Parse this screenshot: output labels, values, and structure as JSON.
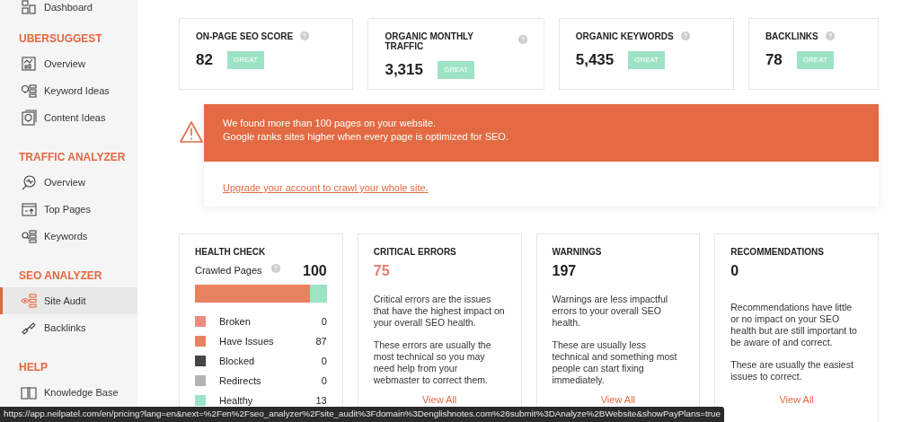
{
  "sidebar": {
    "items": [
      {
        "kind": "link",
        "label": "Dashboard",
        "selected": false
      },
      {
        "kind": "heading",
        "label": "UBERSUGGEST"
      },
      {
        "kind": "link",
        "label": "Overview",
        "selected": false
      },
      {
        "kind": "link",
        "label": "Keyword Ideas",
        "selected": false
      },
      {
        "kind": "link",
        "label": "Content Ideas",
        "selected": false
      },
      {
        "kind": "heading",
        "label": "TRAFFIC ANALYZER"
      },
      {
        "kind": "link",
        "label": "Overview",
        "selected": false
      },
      {
        "kind": "link",
        "label": "Top Pages",
        "selected": false
      },
      {
        "kind": "link",
        "label": "Keywords",
        "selected": false
      },
      {
        "kind": "heading",
        "label": "SEO ANALYZER"
      },
      {
        "kind": "link",
        "label": "Site Audit",
        "selected": true
      },
      {
        "kind": "link",
        "label": "Backlinks",
        "selected": false
      },
      {
        "kind": "heading",
        "label": "HELP"
      },
      {
        "kind": "link",
        "label": "Knowledge Base",
        "selected": false
      }
    ]
  },
  "metrics": [
    {
      "label": "ON-PAGE SEO SCORE",
      "value": "82",
      "badge": "GREAT"
    },
    {
      "label": "ORGANIC MONTHLY TRAFFIC",
      "value": "3,315",
      "badge": "GREAT"
    },
    {
      "label": "ORGANIC KEYWORDS",
      "value": "5,435",
      "badge": "GREAT"
    },
    {
      "label": "BACKLINKS",
      "value": "78",
      "badge": "GREAT"
    }
  ],
  "alert": {
    "lines": [
      "We found more than 100 pages on your website.",
      "Google ranks sites higher when every page is optimized for SEO."
    ],
    "link": "Upgrade your account to crawl your whole site."
  },
  "health_check": {
    "title": "HEALTH CHECK",
    "crawled_label": "Crawled Pages",
    "crawled_value": "100",
    "level": 0.87,
    "legend": [
      {
        "label": "Broken",
        "value": "0",
        "color": "#ef8a80"
      },
      {
        "label": "Have Issues",
        "value": "87",
        "color": "#e9825f"
      },
      {
        "label": "Blocked",
        "value": "0",
        "color": "#444444"
      },
      {
        "label": "Redirects",
        "value": "0",
        "color": "#b3b3b3"
      },
      {
        "label": "Healthy",
        "value": "13",
        "color": "#9de3c5"
      }
    ]
  },
  "issues": [
    {
      "kind": "critical",
      "title": "CRITICAL ERRORS",
      "count": "75",
      "paragraphs": [
        "Critical errors are the issues that have the highest impact on your overall SEO health.",
        "These errors are usually the most technical so you may need help from your webmaster to correct them."
      ],
      "link": "View All"
    },
    {
      "kind": "warning",
      "title": "WARNINGS",
      "count": "197",
      "paragraphs": [
        "Warnings are less impactful errors to your overall SEO health.",
        "These are usually less technical and something most people can start fixing immediately."
      ],
      "link": "View All"
    },
    {
      "kind": "recommendation",
      "title": "RECOMMENDATIONS",
      "count": "0",
      "paragraphs": [
        "Recommendations have little or no impact on your SEO health but are still important to be aware of and correct.",
        "These are usually the easiest issues to correct."
      ],
      "link": "View All"
    }
  ],
  "status_bar": {
    "url": "https://app.neilpatel.com/en/pricing?lang=en&next=%2Fen%2Fseo_analyzer%2Fsite_audit%3Fdomain%3Denglishnotes.com%26submit%3DAnalyze%2BWebsite&showPayPlans=true"
  }
}
